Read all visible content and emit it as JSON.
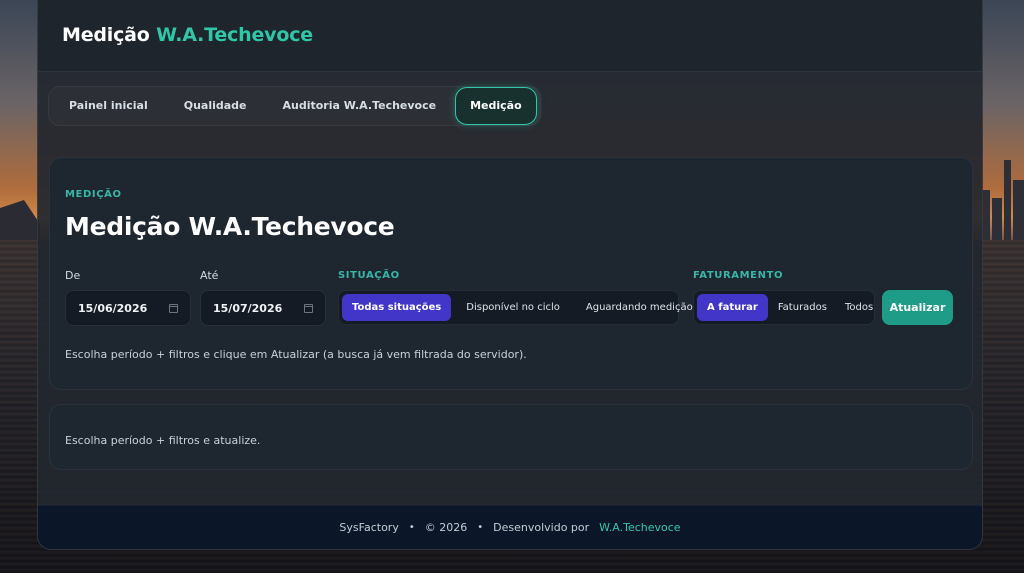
{
  "header": {
    "brand_main": "Medição",
    "brand_accent": "W.A.Techevoce"
  },
  "tabs": [
    {
      "label": "Painel inicial",
      "active": false
    },
    {
      "label": "Qualidade",
      "active": false
    },
    {
      "label": "Auditoria W.A.Techevoce",
      "active": false
    },
    {
      "label": "Medição",
      "active": true
    }
  ],
  "filters": {
    "eyebrow": "MEDIÇÃO",
    "title": "Medição W.A.Techevoce",
    "from_label": "De",
    "from_value": "15/06/2026",
    "to_label": "Até",
    "to_value": "15/07/2026",
    "situacao": {
      "label": "SITUAÇÃO",
      "options": [
        "Todas situações",
        "Disponível no ciclo",
        "Aguardando medição"
      ],
      "selected": "Todas situações"
    },
    "faturamento": {
      "label": "FATURAMENTO",
      "options": [
        "A faturar",
        "Faturados",
        "Todos"
      ],
      "selected": "A faturar"
    },
    "refresh_label": "Atualizar",
    "hint": "Escolha período + filtros e clique em Atualizar (a busca já vem filtrada do servidor)."
  },
  "results": {
    "empty_text": "Escolha período + filtros e atualize."
  },
  "footer": {
    "company": "SysFactory",
    "copyright": "© 2026",
    "dev_prefix": "Desenvolvido por",
    "dev_link": "W.A.Techevoce",
    "separator": "•"
  },
  "colors": {
    "accent": "#2ec8a8",
    "primary_button": "#1e9c88",
    "segment_active": "#4236c9",
    "footer_bg": "#0c1629"
  },
  "icons": {
    "date_picker": "calendar-icon"
  }
}
